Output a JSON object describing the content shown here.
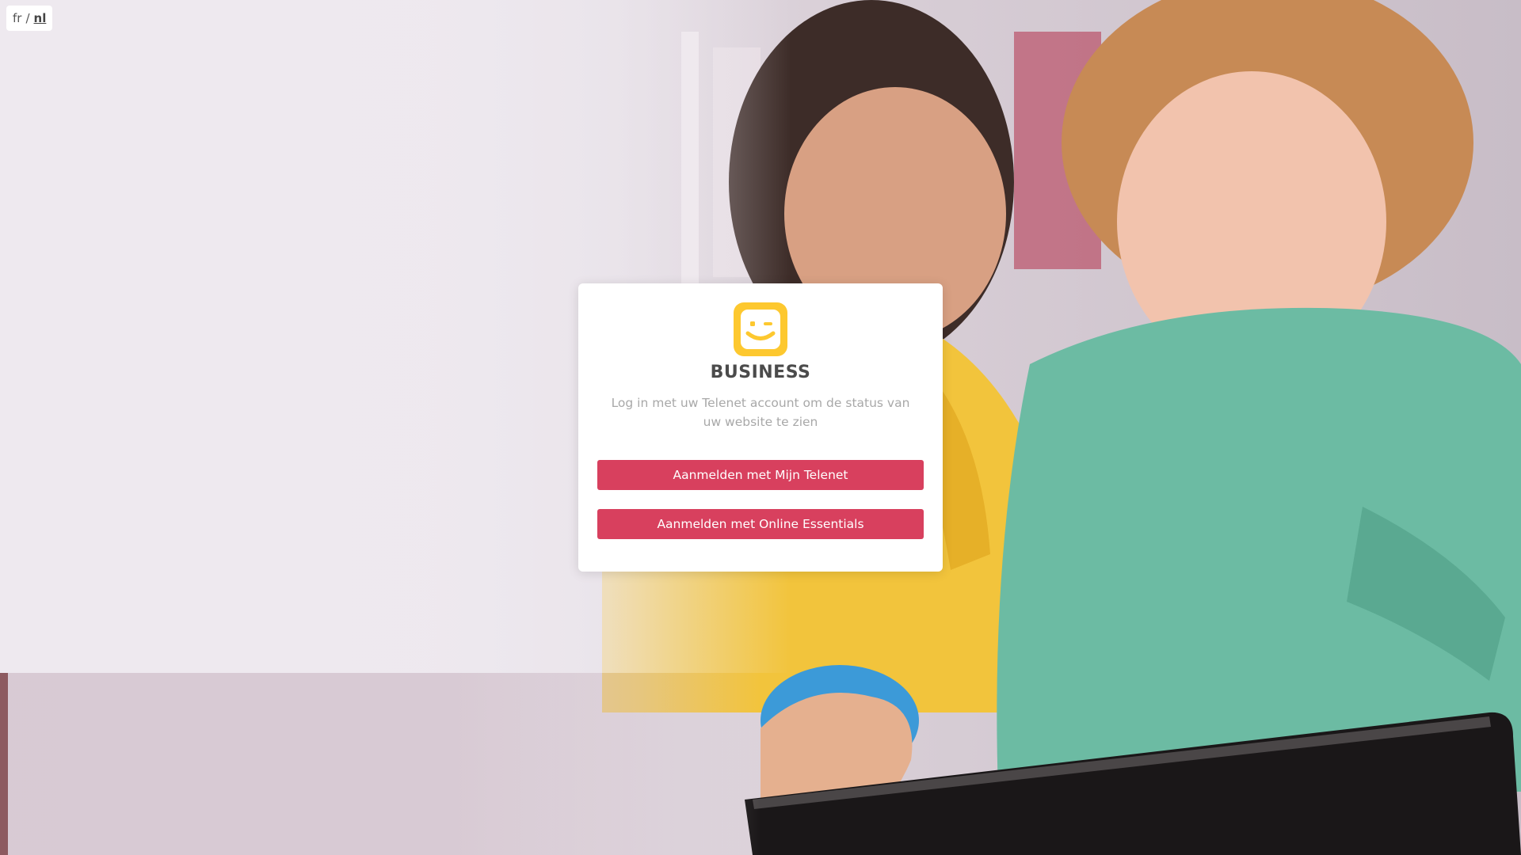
{
  "language_switch": {
    "fr_label": "fr",
    "separator": "/",
    "nl_label": "nl",
    "active": "nl"
  },
  "login_card": {
    "logo_icon": "telenet-logo-icon",
    "brand": "BUSINESS",
    "intro": "Log in met uw Telenet account om de status van uw website te zien",
    "buttons": {
      "mijn_telenet": "Aanmelden met Mijn Telenet",
      "online_essentials": "Aanmelden met Online Essentials"
    }
  },
  "colors": {
    "accent": "#d8405e",
    "logo_yellow": "#fdc82f",
    "brand_text": "#4b4b4b",
    "muted_text": "#a8a8a8"
  },
  "background": {
    "subject": "background-photo"
  }
}
